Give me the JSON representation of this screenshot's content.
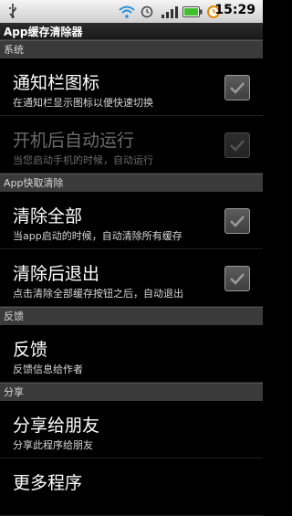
{
  "status_bar": {
    "time": "15:29",
    "icons": [
      "usb-icon",
      "wifi-icon",
      "alarm-icon",
      "signal-icon",
      "battery-icon",
      "alarm-clock-icon"
    ]
  },
  "app": {
    "title": "App缓存清除器"
  },
  "sections": {
    "system": "系统",
    "quick_clear": "App快取清除",
    "feedback": "反馈",
    "share": "分享"
  },
  "items": {
    "notif_icon": {
      "title": "通知栏图标",
      "subtitle": "在通知栏显示图标以便快速切换",
      "checked": true,
      "enabled": true
    },
    "autostart": {
      "title": "开机后自动运行",
      "subtitle": "当您启动手机的时候，自动运行",
      "checked": true,
      "enabled": false
    },
    "clear_all": {
      "title": "清除全部",
      "subtitle": "当app启动的时候，自动清除所有缓存",
      "checked": true,
      "enabled": true
    },
    "clear_exit": {
      "title": "清除后退出",
      "subtitle": "点击清除全部缓存按钮之后，自动退出",
      "checked": true,
      "enabled": true
    },
    "feedback": {
      "title": "反馈",
      "subtitle": "反馈信息给作者"
    },
    "share": {
      "title": "分享给朋友",
      "subtitle": "分享此程序给朋友"
    },
    "more": {
      "title": "更多程序"
    }
  }
}
